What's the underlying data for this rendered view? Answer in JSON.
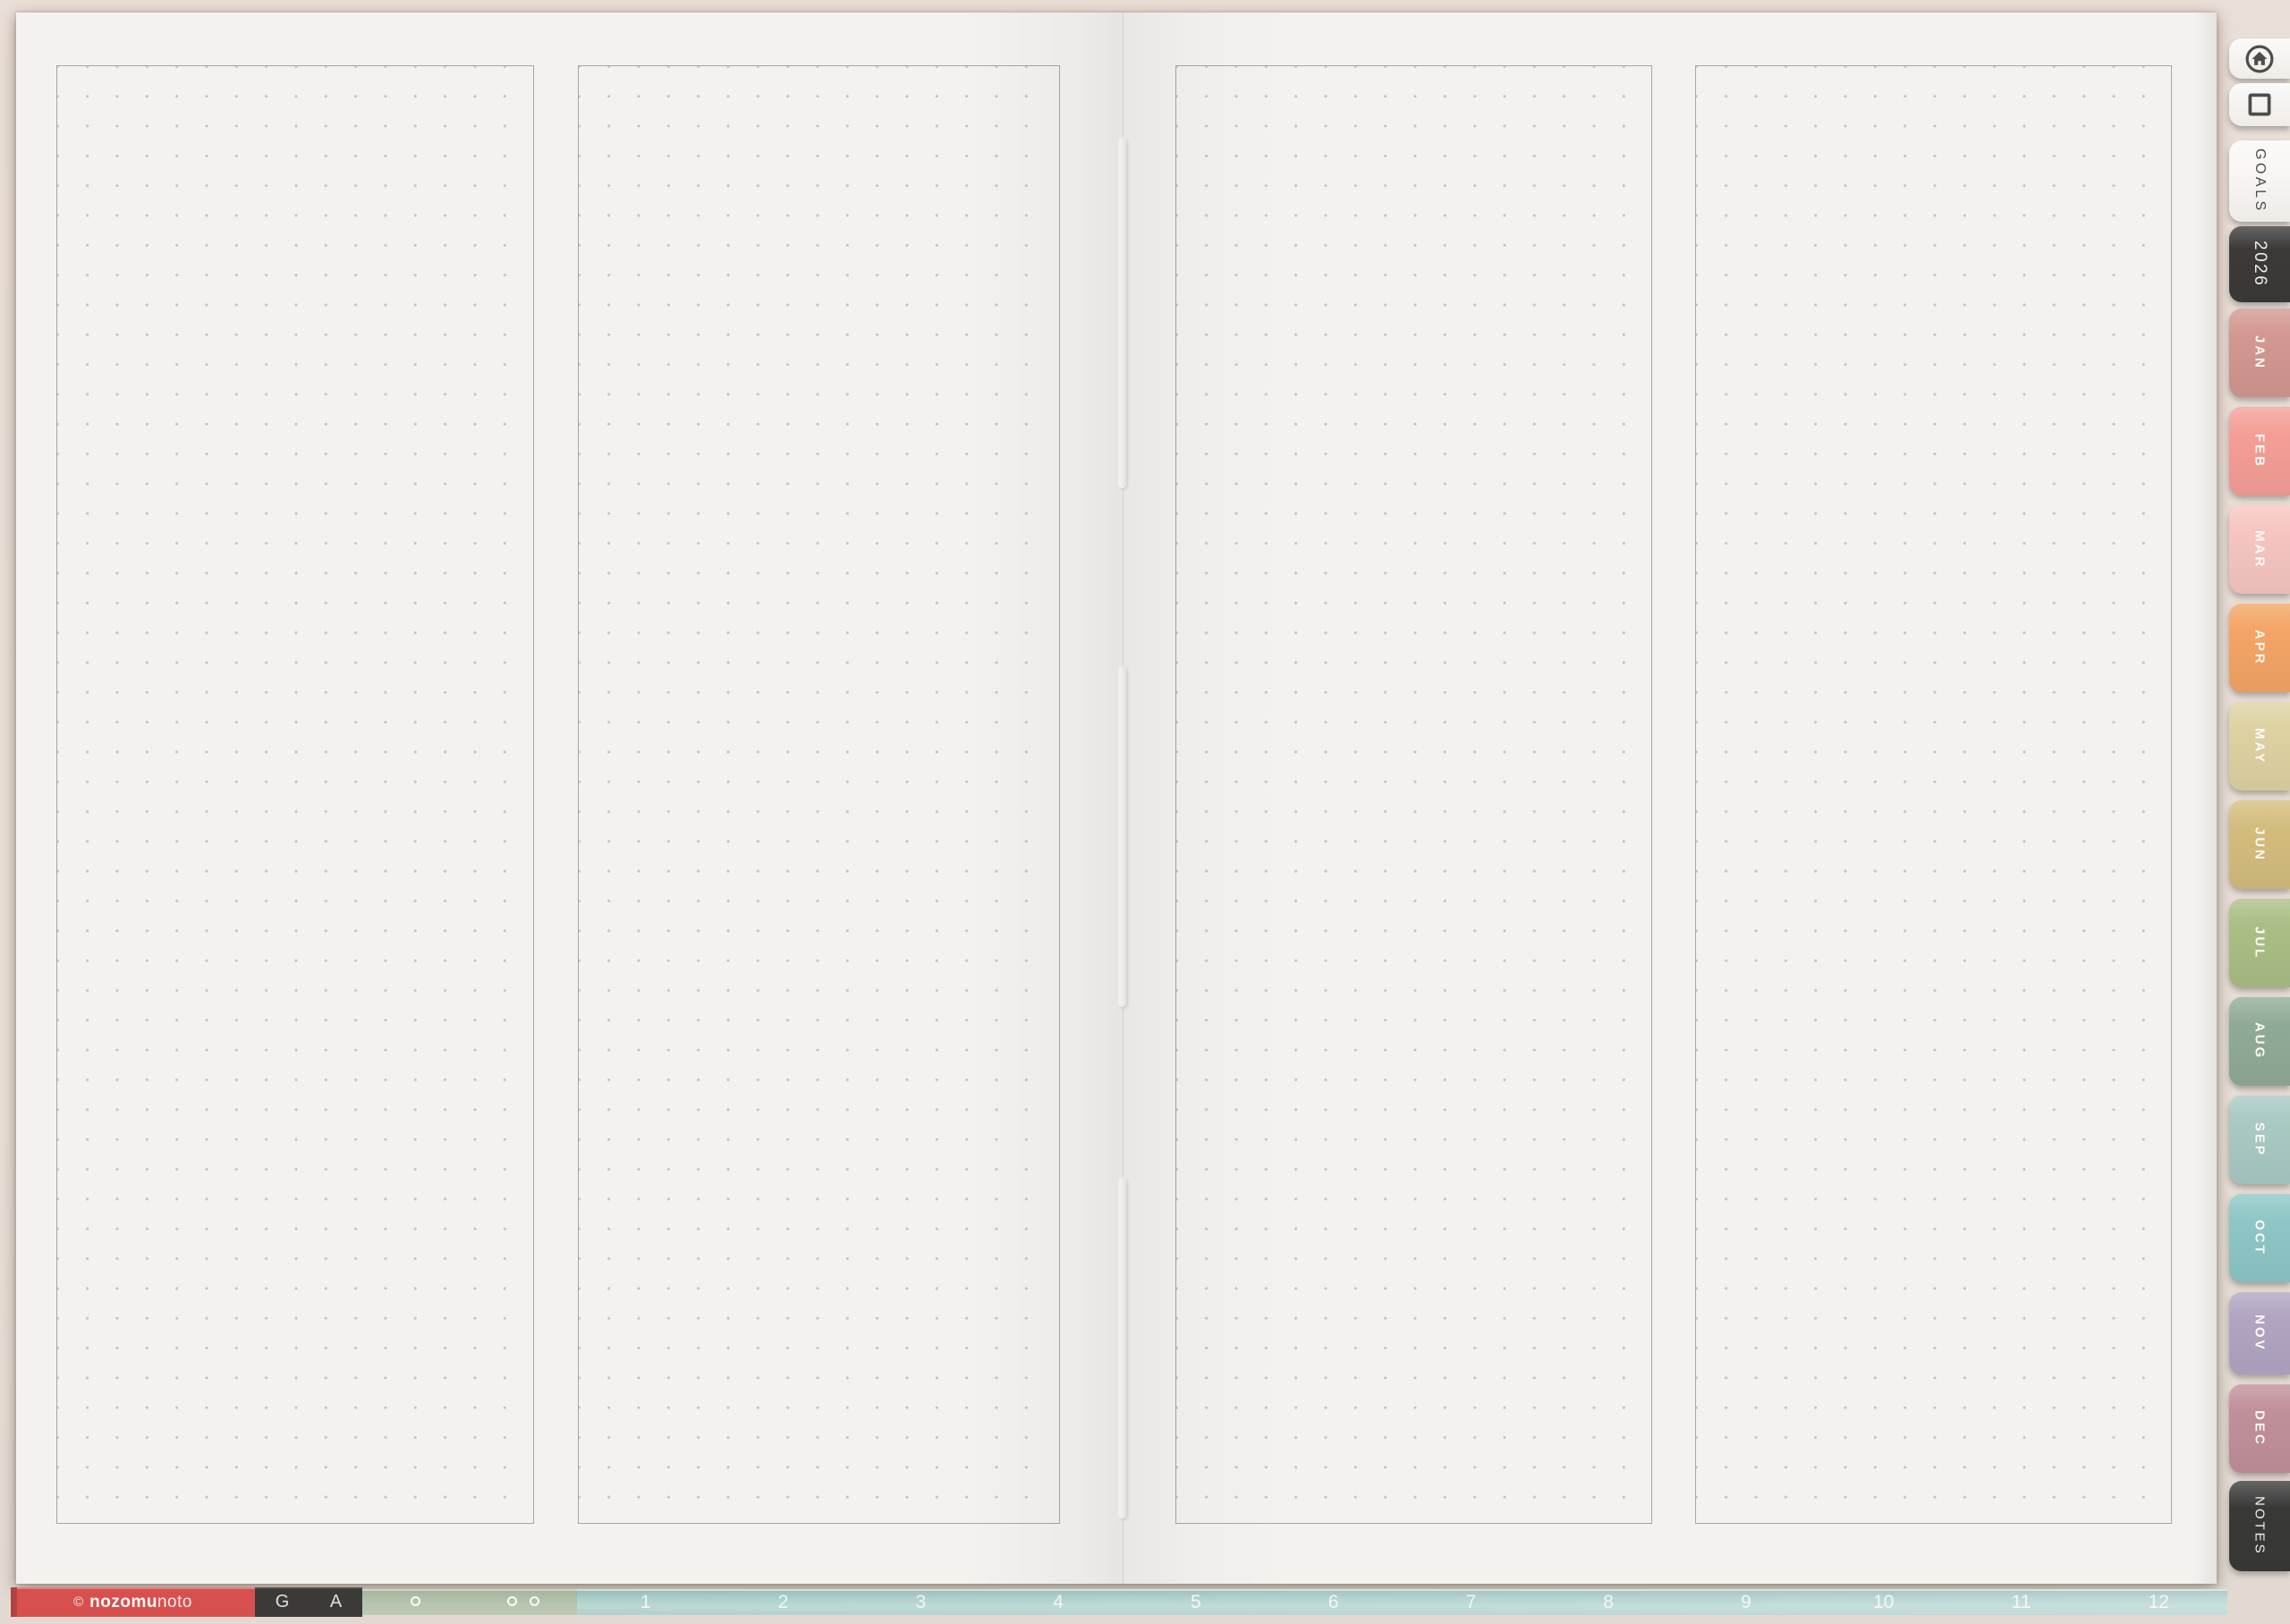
{
  "sidebar": {
    "icon_tabs": [
      {
        "name": "home"
      },
      {
        "name": "cover"
      }
    ],
    "tabs": [
      {
        "label": "GOALS",
        "bg": "#f9f8f5",
        "fg": "#4a4948"
      },
      {
        "label": "2026",
        "bg": "#3b3a38",
        "fg": "#f2efe9"
      },
      {
        "label": "JAN",
        "bg": "#d29790",
        "fg": "#fdf9f6"
      },
      {
        "label": "FEB",
        "bg": "#f49e97",
        "fg": "#fdf9f6"
      },
      {
        "label": "MAR",
        "bg": "#f6c5c1",
        "fg": "#fdf9f6"
      },
      {
        "label": "APR",
        "bg": "#f3a566",
        "fg": "#fdf9f6"
      },
      {
        "label": "MAY",
        "bg": "#ded2a2",
        "fg": "#fdf9f6"
      },
      {
        "label": "JUN",
        "bg": "#d3bd7d",
        "fg": "#fdf9f6"
      },
      {
        "label": "JUL",
        "bg": "#a9bf85",
        "fg": "#fdf9f6"
      },
      {
        "label": "AUG",
        "bg": "#90ab95",
        "fg": "#fdf9f6"
      },
      {
        "label": "SEP",
        "bg": "#a9c9c3",
        "fg": "#fdf9f6"
      },
      {
        "label": "OCT",
        "bg": "#8ec6c6",
        "fg": "#fdf9f6"
      },
      {
        "label": "NOV",
        "bg": "#b1a5c2",
        "fg": "#fdf9f6"
      },
      {
        "label": "DEC",
        "bg": "#c18f9b",
        "fg": "#fdf9f6"
      },
      {
        "label": "NOTES",
        "bg": "#393938",
        "fg": "#f2efe9"
      }
    ]
  },
  "footer": {
    "copyright_symbol": "©",
    "brand_bold": "nozomu",
    "brand_light": "noto",
    "letters": [
      "G",
      "A"
    ],
    "page_numbers": [
      "1",
      "2",
      "3",
      "4",
      "5",
      "6",
      "7",
      "8",
      "9",
      "10",
      "11",
      "12"
    ],
    "colors": {
      "red": "#d7504e",
      "charcoal": "#3b3a38",
      "sage": "#b6c4ae",
      "teal": "#a8cbc7"
    }
  }
}
